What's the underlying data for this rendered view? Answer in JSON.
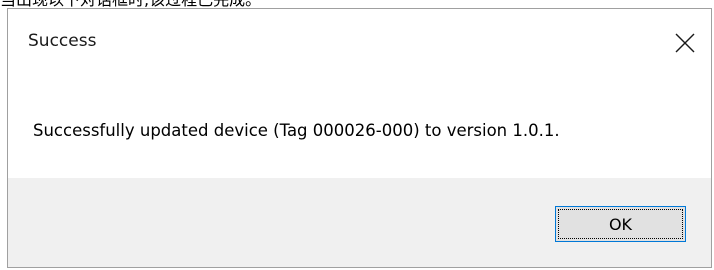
{
  "background": {
    "caption": "当出现以下对话框时,该过程已完成。"
  },
  "dialog": {
    "title": "Success",
    "message": "Successfully updated device (Tag 000026-000) to version 1.0.1.",
    "ok_label": "OK",
    "close_icon": "close-icon"
  },
  "colors": {
    "footer_bg": "#f0f0f0",
    "button_bg": "#e1e1e1",
    "button_border": "#0078d7"
  }
}
